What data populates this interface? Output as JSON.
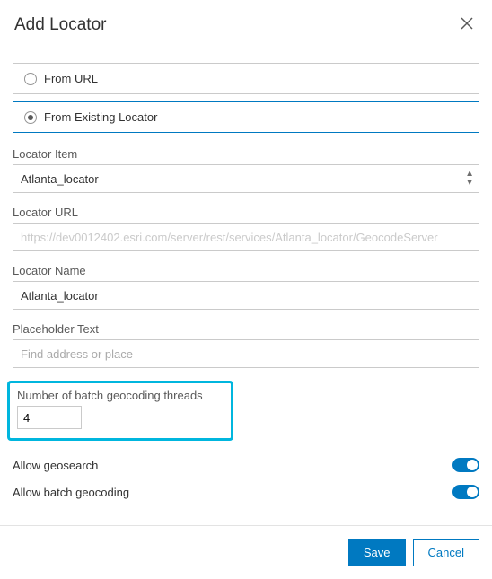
{
  "dialog": {
    "title": "Add Locator",
    "save_label": "Save",
    "cancel_label": "Cancel"
  },
  "source": {
    "from_url_label": "From URL",
    "from_existing_label": "From Existing Locator"
  },
  "locator_item": {
    "label": "Locator Item",
    "value": "Atlanta_locator"
  },
  "locator_url": {
    "label": "Locator URL",
    "value": "https://dev0012402.esri.com/server/rest/services/Atlanta_locator/GeocodeServer"
  },
  "locator_name": {
    "label": "Locator Name",
    "value": "Atlanta_locator"
  },
  "placeholder_text": {
    "label": "Placeholder Text",
    "placeholder": "Find address or place"
  },
  "batch_threads": {
    "label": "Number of batch geocoding threads",
    "value": "4"
  },
  "allow_geosearch": {
    "label": "Allow geosearch"
  },
  "allow_batch": {
    "label": "Allow batch geocoding"
  }
}
